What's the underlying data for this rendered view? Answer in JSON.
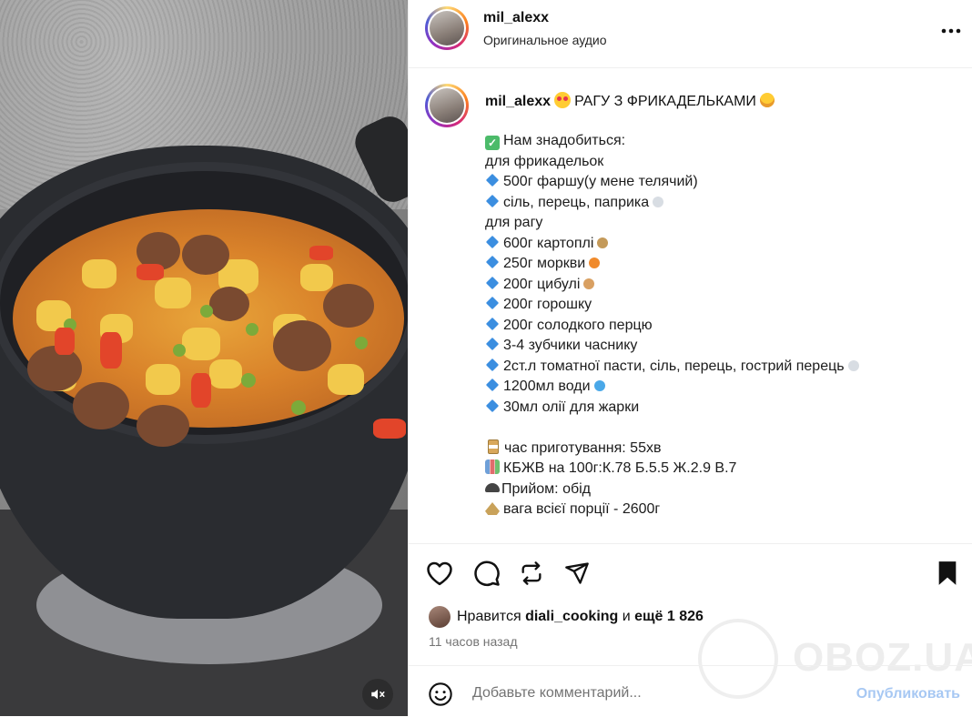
{
  "header": {
    "username": "mil_alexx",
    "audio_label": "Оригинальное аудио",
    "more_icon": "more-horizontal-icon"
  },
  "caption": {
    "username": "mil_alexx",
    "title": "РАГУ З ФРИКАДЕЛЬКАМИ",
    "lines": [
      {
        "emoji": "check",
        "text": "Нам знадобиться:"
      },
      {
        "emoji": "",
        "text": "для фрикадельок"
      },
      {
        "emoji": "diamond",
        "text": "500г фаршу(у мене телячий)"
      },
      {
        "emoji": "diamond",
        "text": "сіль, перець, паприка",
        "suffix": "salt"
      },
      {
        "emoji": "",
        "text": "для рагу"
      },
      {
        "emoji": "diamond",
        "text": "600г картоплі",
        "suffix": "potato"
      },
      {
        "emoji": "diamond",
        "text": "250г моркви",
        "suffix": "carrot"
      },
      {
        "emoji": "diamond",
        "text": "200г цибулі",
        "suffix": "onion"
      },
      {
        "emoji": "diamond",
        "text": "200г горошку"
      },
      {
        "emoji": "diamond",
        "text": "200г солодкого перцю"
      },
      {
        "emoji": "diamond",
        "text": "3-4 зубчики часнику"
      },
      {
        "emoji": "diamond",
        "text": "2ст.л томатної пасти, сіль, перець, гострий перець",
        "suffix": "salt"
      },
      {
        "emoji": "diamond",
        "text": "1200мл води",
        "suffix": "droplet"
      },
      {
        "emoji": "diamond",
        "text": "30мл олії для жарки"
      },
      {
        "emoji": "blank",
        "text": ""
      },
      {
        "emoji": "hourglass",
        "text": "час приготування: 55хв"
      },
      {
        "emoji": "barchart",
        "text": "КБЖВ на 100г:К.78 Б.5.5 Ж.2.9 В.7"
      },
      {
        "emoji": "meal",
        "text": "Прийом: обід"
      },
      {
        "emoji": "scale",
        "text": "вага всієї порції - 2600г"
      }
    ]
  },
  "actions": {
    "like_icon": "heart-icon",
    "comment_icon": "comment-icon",
    "repost_icon": "repost-icon",
    "share_icon": "send-icon",
    "save_icon": "bookmark-icon"
  },
  "likes": {
    "prefix": "Нравится",
    "user": "diali_cooking",
    "middle": "и",
    "count": "ещё 1 826"
  },
  "time_ago": "11 часов назад",
  "comment": {
    "placeholder": "Добавьте комментарий...",
    "publish_label": "Опубликовать"
  },
  "watermark": {
    "text": "OBOZ.UA"
  },
  "media": {
    "mute_icon": "volume-muted-icon"
  },
  "colors": {
    "accent": "#0095f6",
    "publish_disabled": "#a7c8f3",
    "text": "#111111",
    "muted": "#737373",
    "diamond": "#3b8ee0"
  }
}
